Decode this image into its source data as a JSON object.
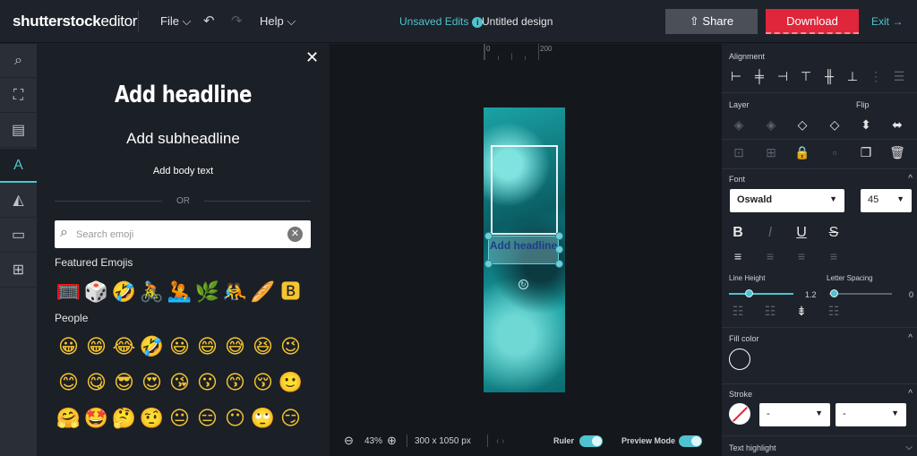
{
  "app": {
    "logo_brand": "shutterstock",
    "logo_suffix": "editor"
  },
  "topbar": {
    "file_menu": "File ⌵",
    "undo_icon": "↶",
    "redo_icon": "↷",
    "help_menu": "Help ⌵",
    "unsaved_label": "Unsaved Edits",
    "info_badge": "i",
    "document_title": "Untitled design",
    "share_label": "⇧ Share",
    "download_label": "Download",
    "exit_label": "Exit →"
  },
  "rail": {
    "items": [
      {
        "icon": "search-icon",
        "glyph": "⌕"
      },
      {
        "icon": "crop-icon",
        "glyph": "⛶"
      },
      {
        "icon": "template-icon",
        "glyph": "▤"
      },
      {
        "icon": "text-icon",
        "glyph": "A"
      },
      {
        "icon": "shapes-icon",
        "glyph": "◭"
      },
      {
        "icon": "folder-icon",
        "glyph": "▭"
      },
      {
        "icon": "add-image-icon",
        "glyph": "⊞"
      }
    ]
  },
  "text_panel": {
    "close_glyph": "✕",
    "headline": "Add headline",
    "subheadline": "Add subheadline",
    "body": "Add body text",
    "or": "OR",
    "search": {
      "placeholder": "Search emoji",
      "value": "",
      "clear_glyph": "✕",
      "icon_glyph": "⌕"
    },
    "featured_label": "Featured Emojis",
    "featured": [
      "🥅",
      "🎲",
      "🤣",
      "🚴",
      "🤽",
      "🌿",
      "🤼",
      "🥖",
      "🅱"
    ],
    "people_label": "People",
    "people_rows": [
      [
        "😀",
        "😁",
        "😂",
        "🤣",
        "😃",
        "😄",
        "😅",
        "😆",
        "😉"
      ],
      [
        "😊",
        "😋",
        "😎",
        "😍",
        "😘",
        "😗",
        "😙",
        "😚",
        "🙂"
      ],
      [
        "🤗",
        "🤩",
        "🤔",
        "🤨",
        "😐",
        "😑",
        "😶",
        "🙄",
        "😏"
      ]
    ]
  },
  "canvas": {
    "ruler_0": "0",
    "ruler_200": "200",
    "headline_text": "Add headline",
    "zoom_out_glyph": "⊖",
    "zoom_value": "43%",
    "zoom_in_glyph": "⊕",
    "dimensions": "300 x 1050 px",
    "page_nav": "‹ ›",
    "ruler_label": "Ruler",
    "ruler_on": true,
    "preview_label": "Preview Mode",
    "preview_on": true
  },
  "properties": {
    "alignment_label": "Alignment",
    "alignment_icons": [
      "⊢",
      "╪",
      "⊣",
      "⊤",
      "╫",
      "⊥",
      "⋮",
      "☰"
    ],
    "layer_label": "Layer",
    "layer_icons": [
      "◈",
      "◈",
      "◇",
      "◇"
    ],
    "flip_label": "Flip",
    "flip_icons": [
      "⬍",
      "⬌"
    ],
    "object_icons": [
      "⊡",
      "⊞",
      "🔒",
      "▫",
      "❐",
      "🗑"
    ],
    "font_label": "Font",
    "font_family": "Oswald",
    "font_size": "45",
    "style_icons": [
      "B",
      "I",
      "U",
      "S"
    ],
    "text_align_icons": [
      "≡",
      "≡",
      "≡",
      "≡"
    ],
    "line_height_label": "Line Height",
    "line_height_value": "1.2",
    "line_height_fraction": 0.25,
    "letter_spacing_label": "Letter Spacing",
    "letter_spacing_value": "0",
    "letter_spacing_fraction": 0.0,
    "list_icons": [
      "☷",
      "☷",
      "⇟",
      "☷"
    ],
    "fill_label": "Fill color",
    "stroke_label": "Stroke",
    "stroke_width_value": "-",
    "stroke_style_value": "-",
    "highlight_label": "Text highlight",
    "chevron_up": "^",
    "chevron_down": "⌵",
    "dropdown_arrow": "▼"
  },
  "colors": {
    "accent": "#4fc3cf",
    "download": "#e0263a",
    "background": "#1b1f26"
  }
}
